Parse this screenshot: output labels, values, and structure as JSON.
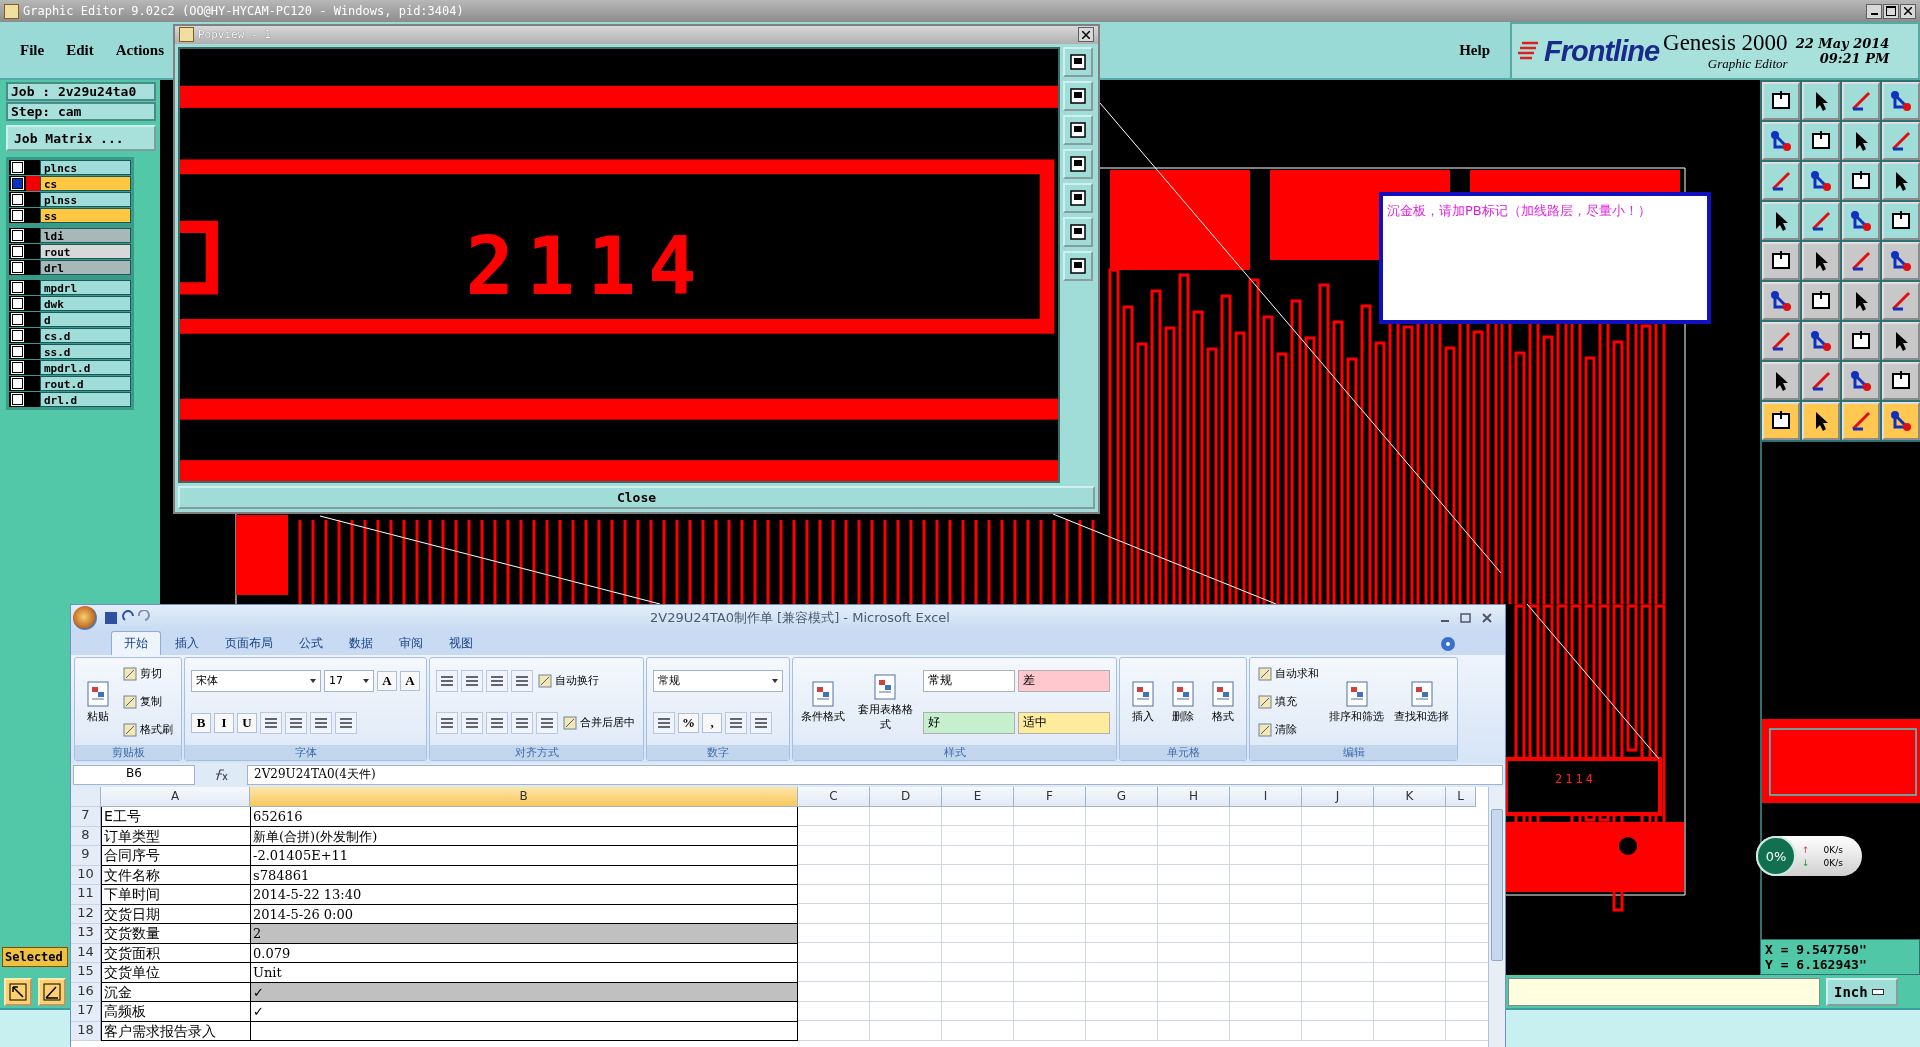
{
  "main_window": {
    "title": "Graphic Editor 9.02c2 (OO@HY-HYCAM-PC120 - Windows, pid:3404)"
  },
  "menu": [
    "File",
    "Edit",
    "Actions"
  ],
  "help_menu": "Help",
  "brand": {
    "logo": "Frontline",
    "product": "Genesis 2000",
    "subtitle": "Graphic Editor",
    "date": "22 May 2014",
    "time": "09:21 PM"
  },
  "job": {
    "job": "Job : 2v29u24ta0",
    "step": "Step: cam",
    "matrix_button": "Job Matrix ..."
  },
  "layer_groups": [
    {
      "layers": [
        {
          "name": "plncs",
          "color": "#a0dcd8",
          "selected": false
        },
        {
          "name": "cs",
          "color": "#ffc840",
          "selected": true
        },
        {
          "name": "plnss",
          "color": "#a0dcd8",
          "selected": false
        },
        {
          "name": "ss",
          "color": "#ffc840",
          "selected": false
        }
      ]
    },
    {
      "layers": [
        {
          "name": "ldi",
          "color": "#a8b8b8",
          "selected": false
        },
        {
          "name": "rout",
          "color": "#d8d8d8",
          "selected": false
        },
        {
          "name": "drl",
          "color": "#a8b8b8",
          "selected": false
        }
      ]
    },
    {
      "layers": [
        {
          "name": "mpdrl",
          "color": "#a0dcd8",
          "selected": false
        },
        {
          "name": "dwk",
          "color": "#a0dcd8",
          "selected": false
        },
        {
          "name": "d",
          "color": "#a0dcd8",
          "selected": false
        },
        {
          "name": "cs.d",
          "color": "#a0dcd8",
          "selected": false
        },
        {
          "name": "ss.d",
          "color": "#a0dcd8",
          "selected": false
        },
        {
          "name": "mpdrl.d",
          "color": "#a0dcd8",
          "selected": false
        },
        {
          "name": "rout.d",
          "color": "#a0dcd8",
          "selected": false
        },
        {
          "name": "drl.d",
          "color": "#a0dcd8",
          "selected": false
        }
      ]
    }
  ],
  "popview": {
    "title": "Popview - 1",
    "display_text": "2114",
    "close_button": "Close"
  },
  "note": "沉金板，请加PB标记（加线路层，尽量小！）",
  "canvas_label": "2114",
  "speed_widget": {
    "percent": "0%",
    "upload_arrow": "↑",
    "upload": "0K/s",
    "download_arrow": "↓",
    "download": "0K/s"
  },
  "coordinates": {
    "x": "X = 9.547750\"",
    "y": "Y = 6.162943\""
  },
  "status": {
    "selected_label": "Selected",
    "units_button": "Inch"
  },
  "excel": {
    "title": "2V29U24TA0制作单  [兼容模式] - Microsoft Excel",
    "tabs": [
      {
        "label": "开始",
        "selected": true
      },
      {
        "label": "插入",
        "selected": false
      },
      {
        "label": "页面布局",
        "selected": false
      },
      {
        "label": "公式",
        "selected": false
      },
      {
        "label": "数据",
        "selected": false
      },
      {
        "label": "审阅",
        "selected": false
      },
      {
        "label": "视图",
        "selected": false
      }
    ],
    "ribbon_groups": [
      {
        "label": "剪贴板",
        "columns": [
          [
            [
              {
                "kind": "big",
                "label": "粘贴"
              }
            ]
          ],
          [
            [
              {
                "kind": "small",
                "label": "剪切"
              }
            ],
            [
              {
                "kind": "small",
                "label": "复制"
              }
            ],
            [
              {
                "kind": "small",
                "label": "格式刷"
              }
            ]
          ]
        ]
      },
      {
        "label": "字体",
        "columns": [
          [
            [
              {
                "kind": "field",
                "value": "宋体"
              },
              {
                "kind": "field",
                "value": "17"
              },
              {
                "kind": "glyph",
                "label": "A"
              },
              {
                "kind": "glyph",
                "label": "A"
              }
            ],
            [
              {
                "kind": "glyph",
                "label": "B"
              },
              {
                "kind": "glyph",
                "label": "I"
              },
              {
                "kind": "glyph",
                "label": "U"
              },
              {
                "kind": "icon"
              },
              {
                "kind": "icon"
              },
              {
                "kind": "icon"
              },
              {
                "kind": "icon"
              }
            ]
          ]
        ]
      },
      {
        "label": "对齐方式",
        "columns": [
          [
            [
              {
                "kind": "icon"
              },
              {
                "kind": "icon"
              },
              {
                "kind": "icon"
              },
              {
                "kind": "icon"
              },
              {
                "kind": "small",
                "label": "自动换行"
              }
            ],
            [
              {
                "kind": "icon"
              },
              {
                "kind": "icon"
              },
              {
                "kind": "icon"
              },
              {
                "kind": "icon"
              },
              {
                "kind": "icon"
              },
              {
                "kind": "small",
                "label": "合并后居中"
              }
            ]
          ]
        ]
      },
      {
        "label": "数字",
        "columns": [
          [
            [
              {
                "kind": "field",
                "value": "常规"
              }
            ],
            [
              {
                "kind": "icon"
              },
              {
                "kind": "glyph",
                "label": "%"
              },
              {
                "kind": "glyph",
                "label": ","
              },
              {
                "kind": "icon"
              },
              {
                "kind": "icon"
              }
            ]
          ]
        ]
      },
      {
        "label": "样式",
        "columns": [
          [
            [
              {
                "kind": "big",
                "label": "条件格式"
              }
            ]
          ],
          [
            [
              {
                "kind": "big",
                "label": "套用表格格式"
              }
            ]
          ],
          [
            [
              {
                "kind": "style",
                "label": "常规",
                "color": "#ffffff"
              },
              {
                "kind": "style",
                "label": "差",
                "color": "#ffc7ce"
              }
            ],
            [
              {
                "kind": "style",
                "label": "好",
                "color": "#c6efce"
              },
              {
                "kind": "style",
                "label": "适中",
                "color": "#ffeb9c"
              }
            ]
          ]
        ]
      },
      {
        "label": "单元格",
        "columns": [
          [
            [
              {
                "kind": "big",
                "label": "插入"
              }
            ]
          ],
          [
            [
              {
                "kind": "big",
                "label": "删除"
              }
            ]
          ],
          [
            [
              {
                "kind": "big",
                "label": "格式"
              }
            ]
          ]
        ]
      },
      {
        "label": "编辑",
        "columns": [
          [
            [
              {
                "kind": "small",
                "label": "自动求和"
              }
            ],
            [
              {
                "kind": "small",
                "label": "填充"
              }
            ],
            [
              {
                "kind": "small",
                "label": "清除"
              }
            ]
          ],
          [
            [
              {
                "kind": "big",
                "label": "排序和筛选"
              }
            ]
          ],
          [
            [
              {
                "kind": "big",
                "label": "查找和选择"
              }
            ]
          ]
        ]
      }
    ],
    "name_box": "B6",
    "formula": "2V29U24TA0(4天件)",
    "columns": [
      {
        "label": "A",
        "selected": false
      },
      {
        "label": "B",
        "selected": true
      },
      {
        "label": "C",
        "selected": false
      },
      {
        "label": "D",
        "selected": false
      },
      {
        "label": "E",
        "selected": false
      },
      {
        "label": "F",
        "selected": false
      },
      {
        "label": "G",
        "selected": false
      },
      {
        "label": "H",
        "selected": false
      },
      {
        "label": "I",
        "selected": false
      },
      {
        "label": "J",
        "selected": false
      },
      {
        "label": "K",
        "selected": false
      },
      {
        "label": "L",
        "selected": false
      }
    ],
    "rows": [
      {
        "number": "7",
        "a": "E工号",
        "b": "652616",
        "shaded": false
      },
      {
        "number": "8",
        "a": "订单类型",
        "b": "新单(合拼)(外发制作)",
        "shaded": false
      },
      {
        "number": "9",
        "a": "合同序号",
        "b": "-2.01405E+11",
        "shaded": false
      },
      {
        "number": "10",
        "a": "文件名称",
        "b": "s784861",
        "shaded": false
      },
      {
        "number": "11",
        "a": "下单时间",
        "b": "2014-5-22 13:40",
        "shaded": false
      },
      {
        "number": "12",
        "a": "交货日期",
        "b": "2014-5-26 0:00",
        "shaded": false
      },
      {
        "number": "13",
        "a": "交货数量",
        "b": "2",
        "shaded": true
      },
      {
        "number": "14",
        "a": "交货面积",
        "b": "0.079",
        "shaded": false
      },
      {
        "number": "15",
        "a": "交货单位",
        "b": "Unit",
        "shaded": false
      },
      {
        "number": "16",
        "a": "沉金",
        "b": "✓",
        "shaded": true
      },
      {
        "number": "17",
        "a": "高频板",
        "b": "✓",
        "shaded": false
      },
      {
        "number": "18",
        "a": "客户需求报告录入",
        "b": "",
        "shaded": false
      }
    ]
  }
}
